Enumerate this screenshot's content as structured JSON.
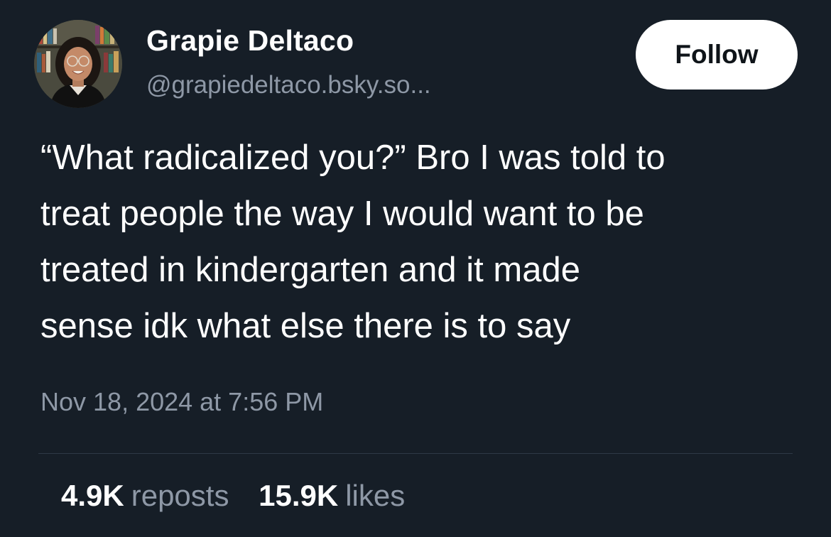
{
  "author": {
    "name": "Grapie Deltaco",
    "handle": "@grapiedeltaco.bsky.so..."
  },
  "follow_label": "Follow",
  "post": {
    "lines": [
      "“What radicalized you?” Bro I was told to",
      "treat people the way I would want to be",
      "treated in kindergarten and it made",
      "sense idk what else there is to say"
    ],
    "timestamp": "Nov 18, 2024 at 7:56 PM"
  },
  "stats": {
    "reposts_count": "4.9K",
    "reposts_label": "reposts",
    "likes_count": "15.9K",
    "likes_label": "likes"
  },
  "colors": {
    "background": "#161e27",
    "text_primary": "#ffffff",
    "text_secondary": "#8e98a6",
    "divider": "#2e3946",
    "button_bg": "#ffffff"
  }
}
